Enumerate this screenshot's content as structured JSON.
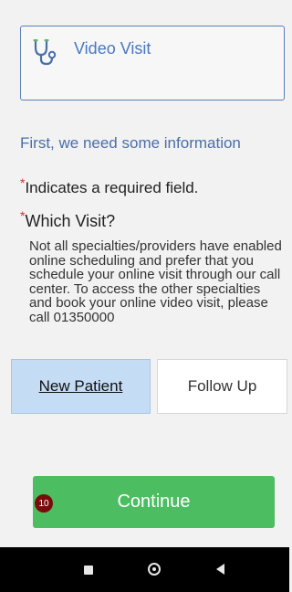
{
  "visit_card": {
    "icon": "stethoscope-icon",
    "title": "Video Visit"
  },
  "intro": "First, we need some information",
  "required_note": {
    "star": "*",
    "text": "Indicates a required field."
  },
  "which_visit": {
    "star": "*",
    "label": "Which Visit?",
    "description": "Not all specialties/providers have enabled online scheduling and prefer that you schedule your online visit through our call center. To access the other specialties and book your online video visit, please call 01350000"
  },
  "visit_type_options": {
    "new_patient": "New Patient",
    "follow_up": "Follow Up",
    "selected": "New Patient"
  },
  "continue_button": {
    "label": "Continue",
    "badge": "10"
  },
  "nav_bar": {
    "recents": "recents-square-icon",
    "home": "home-circle-icon",
    "back": "back-triangle-icon"
  },
  "colors": {
    "accent_blue": "#4a78c2",
    "selected_bg": "#c5dcf5",
    "continue_green": "#4dbd62",
    "required_red": "#c0392b",
    "badge_red": "#7a0b0b"
  }
}
